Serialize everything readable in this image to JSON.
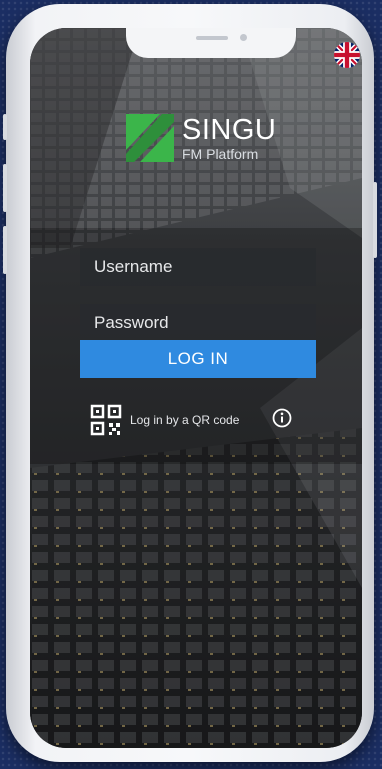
{
  "language": {
    "flag_icon": "uk-flag-icon"
  },
  "brand": {
    "name": "SINGU",
    "subtitle": "FM Platform",
    "color": "#3bb54a"
  },
  "login_form": {
    "username_placeholder": "Username",
    "password_placeholder": "Password",
    "login_label": "LOG IN",
    "login_button_color": "#2f8ae0"
  },
  "qr_login": {
    "label": "Log in by a QR code",
    "icon": "qr-code-icon",
    "info_icon": "info-icon"
  },
  "colors": {
    "background": "#1b2e63",
    "device_frame": "#f4f5f7"
  }
}
